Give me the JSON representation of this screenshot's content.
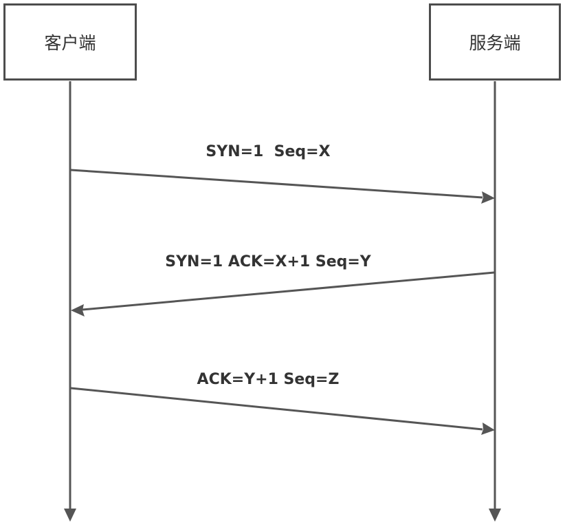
{
  "participants": {
    "client": "客户端",
    "server": "服务端"
  },
  "messages": [
    {
      "label": "SYN=1  Seq=X",
      "from": "client",
      "to": "server"
    },
    {
      "label": "SYN=1 ACK=X+1 Seq=Y",
      "from": "server",
      "to": "client"
    },
    {
      "label": "ACK=Y+1 Seq=Z",
      "from": "client",
      "to": "server"
    }
  ],
  "colors": {
    "line": "#555555",
    "text": "#333333"
  }
}
